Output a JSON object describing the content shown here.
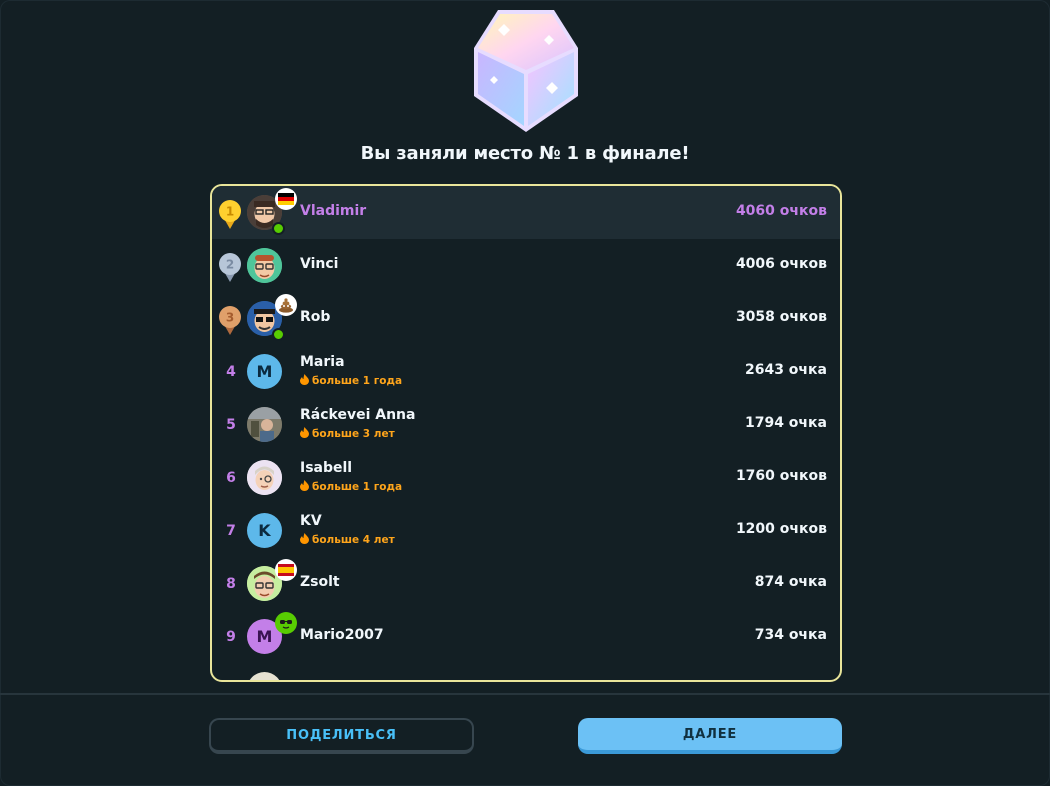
{
  "header": {
    "title": "Вы заняли место № 1 в финале!"
  },
  "leaderboard": {
    "rows": [
      {
        "rank": "1",
        "name": "Vladimir",
        "points": "4060 очков",
        "streak": ""
      },
      {
        "rank": "2",
        "name": "Vinci",
        "points": "4006 очков",
        "streak": ""
      },
      {
        "rank": "3",
        "name": "Rob",
        "points": "3058 очков",
        "streak": ""
      },
      {
        "rank": "4",
        "name": "Maria",
        "points": "2643 очка",
        "streak": "больше 1 года",
        "initial": "M"
      },
      {
        "rank": "5",
        "name": "Ráckevei Anna",
        "points": "1794 очка",
        "streak": "больше 3 лет"
      },
      {
        "rank": "6",
        "name": "Isabell",
        "points": "1760 очков",
        "streak": "больше 1 года"
      },
      {
        "rank": "7",
        "name": "KV",
        "points": "1200 очков",
        "streak": "больше 4 лет",
        "initial": "K"
      },
      {
        "rank": "8",
        "name": "Zsolt",
        "points": "874 очка",
        "streak": ""
      },
      {
        "rank": "9",
        "name": "Mario2007",
        "points": "734 очка",
        "streak": "",
        "initial": "M"
      }
    ]
  },
  "footer": {
    "share_label": "ПОДЕЛИТЬСЯ",
    "next_label": "ДАЛЕЕ"
  },
  "colors": {
    "accent": "#c37fe8",
    "streak": "#ffa51b",
    "border": "#e9e59a",
    "next_button": "#6cc1f5"
  },
  "icons": [
    "diamond-league-gem-icon",
    "gold-medal-icon",
    "silver-medal-icon",
    "bronze-medal-icon",
    "germany-flag-icon",
    "spain-flag-icon",
    "poop-emoji-icon",
    "sunglasses-emoji-icon",
    "fire-icon"
  ]
}
